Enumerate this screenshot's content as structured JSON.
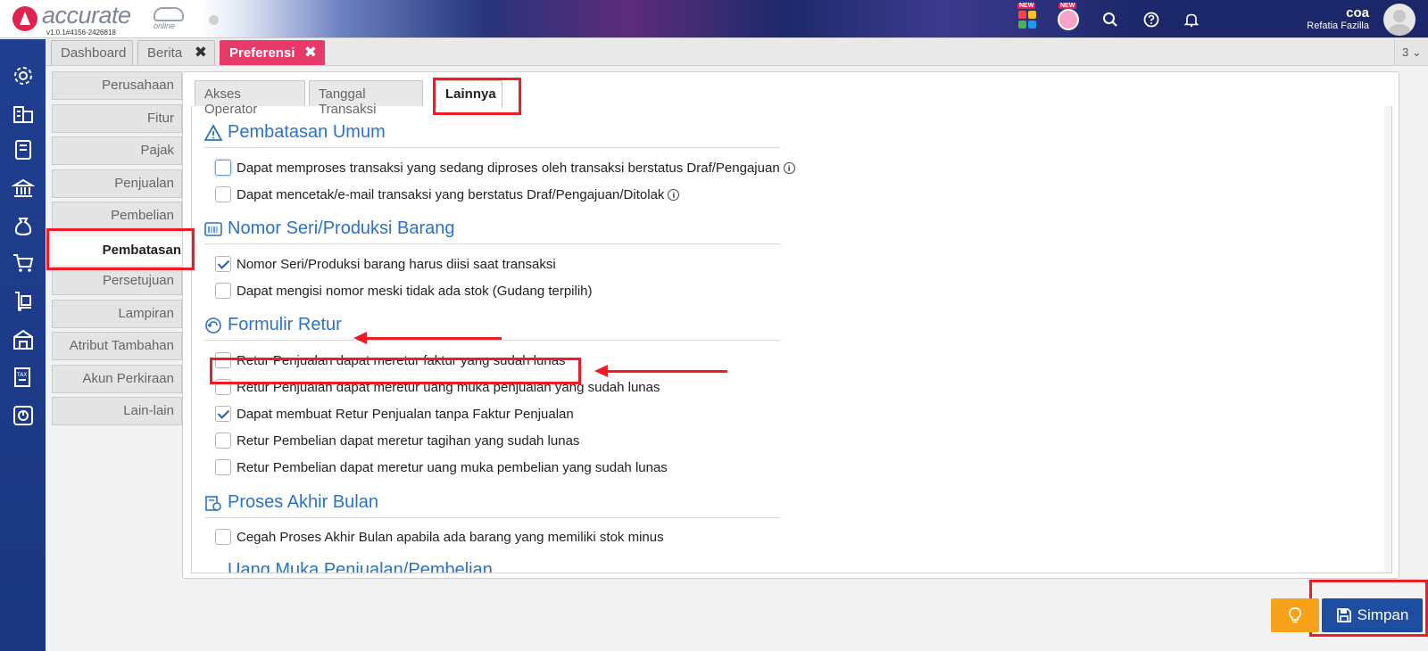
{
  "header": {
    "logo_text": "accurate",
    "logo_sub": "online",
    "version": "v1.0.1#4156-2426818",
    "new_badge_1": "NEW",
    "new_badge_2": "NEW",
    "user": {
      "name": "coa",
      "subtitle": "Refatia Fazilla"
    }
  },
  "tabs": [
    {
      "label": "Dashboard"
    },
    {
      "label": "Berita"
    },
    {
      "label": "Preferensi"
    }
  ],
  "tab_close_glyph": "✖",
  "tab_count": "3 ⌄",
  "side_menu": [
    "Perusahaan",
    "Fitur",
    "Pajak",
    "Penjualan",
    "Pembelian",
    "Pembatasan",
    "Persetujuan",
    "Lampiran",
    "Atribut Tambahan",
    "Akun Perkiraan",
    "Lain-lain"
  ],
  "side_menu_active": "Pembatasan",
  "subtabs": [
    {
      "label": "Akses Operator"
    },
    {
      "label": "Tanggal Transaksi"
    },
    {
      "label": "Lainnya"
    }
  ],
  "sections": [
    {
      "title": "Pembatasan Umum",
      "icon": "warning-icon",
      "options": [
        {
          "label": "Dapat memproses transaksi yang sedang diproses oleh transaksi berstatus Draf/Pengajuan",
          "checked": false,
          "info": true
        },
        {
          "label": "Dapat mencetak/e-mail transaksi yang berstatus Draf/Pengajuan/Ditolak",
          "checked": false,
          "info": true
        }
      ]
    },
    {
      "title": "Nomor Seri/Produksi Barang",
      "icon": "barcode-icon",
      "options": [
        {
          "label": "Nomor Seri/Produksi barang harus diisi saat transaksi",
          "checked": true
        },
        {
          "label": "Dapat mengisi nomor meski tidak ada stok (Gudang terpilih)",
          "checked": false
        }
      ]
    },
    {
      "title": "Formulir Retur",
      "icon": "return-icon",
      "options": [
        {
          "label": "Retur Penjualan dapat meretur faktur yang sudah lunas",
          "checked": false
        },
        {
          "label": "Retur Penjualan dapat meretur uang muka penjualan yang sudah lunas",
          "checked": false
        },
        {
          "label": "Dapat membuat Retur Penjualan tanpa Faktur Penjualan",
          "checked": true
        },
        {
          "label": "Retur Pembelian dapat meretur tagihan yang sudah lunas",
          "checked": false
        },
        {
          "label": "Retur Pembelian dapat meretur uang muka pembelian yang sudah lunas",
          "checked": false
        }
      ]
    },
    {
      "title": "Proses Akhir Bulan",
      "icon": "calendar-process-icon",
      "options": [
        {
          "label": "Cegah Proses Akhir Bulan apabila ada barang yang memiliki stok minus",
          "checked": false
        }
      ]
    }
  ],
  "partial_section_title": "Uang Muka Penjualan/Pembelian",
  "buttons": {
    "save": "Simpan",
    "tips_icon": "lightbulb-icon"
  },
  "colors": {
    "accent": "#e8396b",
    "primary": "#1d4ea2",
    "section_title": "#2a73c3",
    "warning_button": "#f7a21b",
    "annotation": "#ee1c25"
  }
}
